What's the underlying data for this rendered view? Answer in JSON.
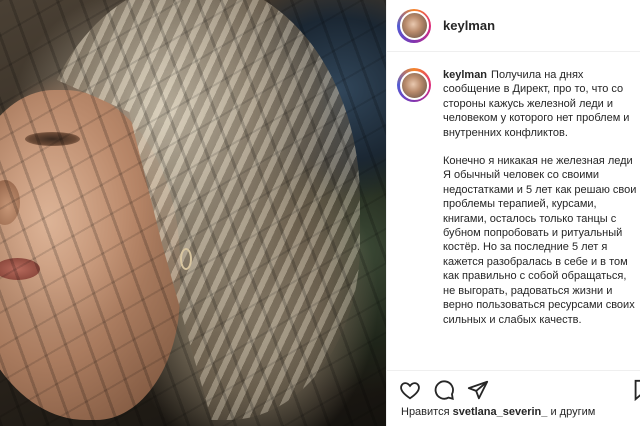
{
  "post": {
    "username": "keylman",
    "caption": {
      "username": "keylman",
      "paragraph1": "Получила на днях сообщение в Директ, про то, что со стороны кажусь железной леди и человеком у которого нет проблем и внутренних конфликтов.",
      "paragraph2": "Конечно я никакая не железная леди",
      "paragraph3": "Я обычный человек со своими недостатками и 5 лет как решаю свои проблемы терапией, курсами, книгами, осталось только танцы с бубном попробовать и ритуальный костёр. Но за последние 5 лет я кажется разобралась в себе и в том как правильно с собой обращаться, не выгорать, радоваться жизни и верно пользоваться ресурсами своих сильных и слабых качеств."
    },
    "likes": {
      "prefix": "Нравится",
      "user": "svetlana_severin_",
      "suffix": "и другим"
    }
  },
  "icons": [
    "heart-icon",
    "comment-icon",
    "share-icon",
    "bookmark-icon"
  ],
  "colors": {
    "text": "#262626",
    "border": "#efefef",
    "background": "#ffffff"
  }
}
